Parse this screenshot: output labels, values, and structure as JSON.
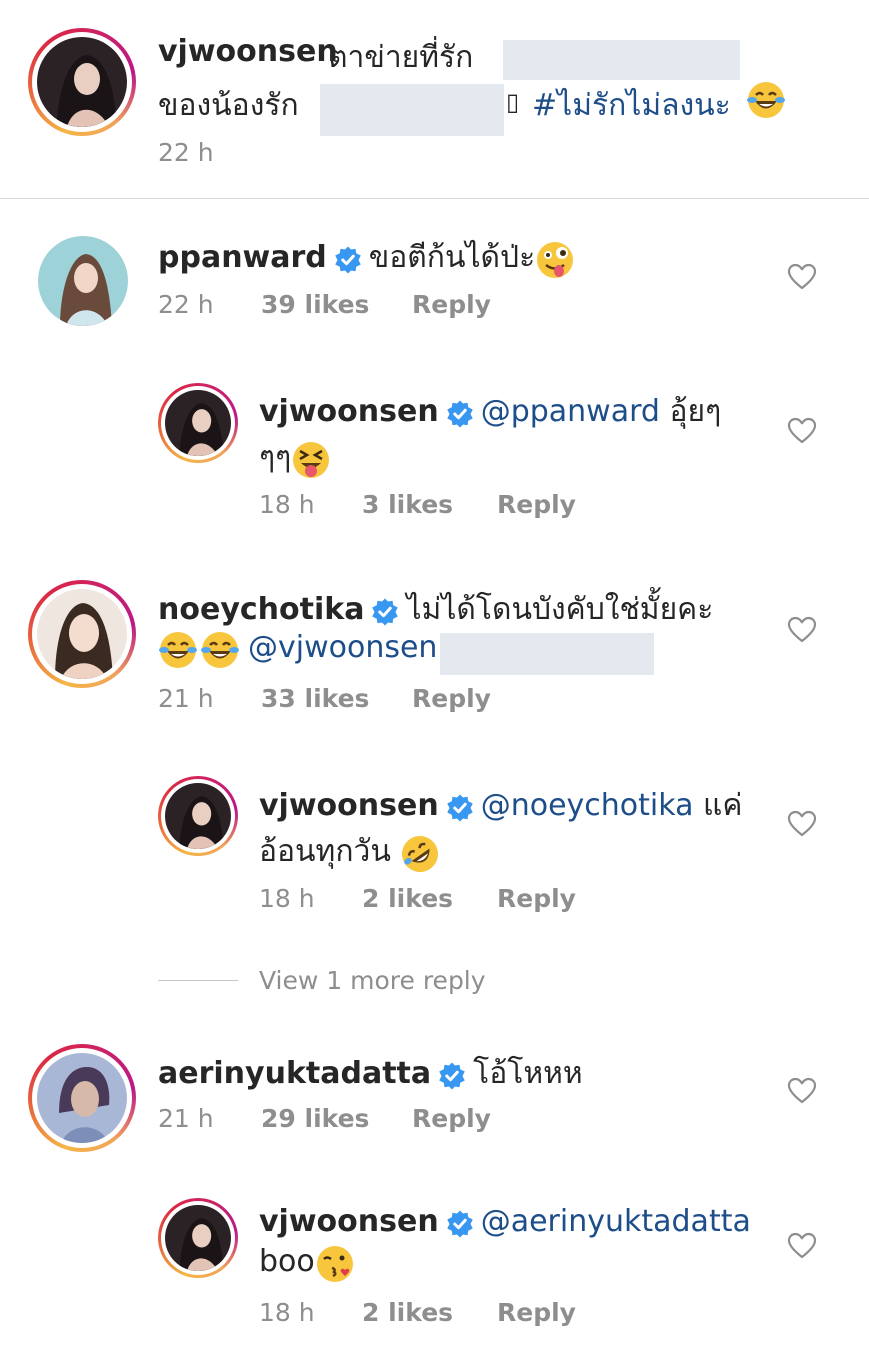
{
  "caption": {
    "username": "vjwoonsen",
    "text_line1": "ตาข่ายที่รัก",
    "text_line2": "ของน้องรัก",
    "missing_glyph": "▯",
    "hashtag": "#ไม่รักไม่ลงนะ",
    "emoji": "joy-emoji",
    "time": "22 h"
  },
  "comments": [
    {
      "username": "ppanward",
      "verified": true,
      "text": "ขอตีก้นได้ป่ะ",
      "emoji": "zany-face-emoji",
      "time": "22 h",
      "likes": "39 likes",
      "reply_label": "Reply"
    },
    {
      "username": "vjwoonsen",
      "verified": true,
      "mention": "@ppanward",
      "text_line1": " อุ้ยๆ",
      "text_line2": "ๆๆ",
      "emoji": "squinting-tongue-emoji",
      "time": "18 h",
      "likes": "3 likes",
      "reply_label": "Reply"
    },
    {
      "username": "noeychotika",
      "verified": true,
      "text": "ไม่ได้โดนบังคับใช่มั้ยคะ",
      "mention": "@vjwoonsen",
      "emoji": "joy-emoji",
      "time": "21 h",
      "likes": "33 likes",
      "reply_label": "Reply"
    },
    {
      "username": "vjwoonsen",
      "verified": true,
      "mention": "@noeychotika",
      "text_line1": " แค่",
      "text_line2": "อ้อนทุกวัน ",
      "emoji": "rofl-emoji",
      "time": "18 h",
      "likes": "2 likes",
      "reply_label": "Reply"
    },
    {
      "username": "aerinyuktadatta",
      "verified": true,
      "text": "โอ้โหหห",
      "time": "21 h",
      "likes": "29 likes",
      "reply_label": "Reply"
    },
    {
      "username": "vjwoonsen",
      "verified": true,
      "mention": "@aerinyuktadatta",
      "text_line2": "boo",
      "emoji": "kissing-heart-emoji",
      "time": "18 h",
      "likes": "2 likes",
      "reply_label": "Reply"
    }
  ],
  "view_more": "View 1 more reply",
  "colors": {
    "text": "#262626",
    "meta": "#8e8e8e",
    "mention": "#1d4e8a",
    "verified": "#3897f0",
    "redaction": "#e4e9ef"
  }
}
